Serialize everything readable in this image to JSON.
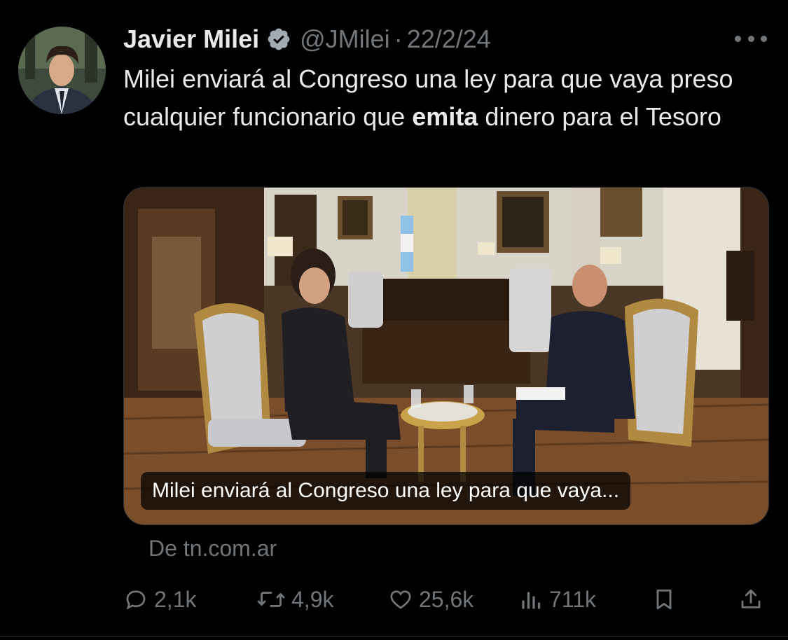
{
  "author": {
    "name": "Javier Milei",
    "handle": "@JMilei",
    "separator": "·",
    "date": "22/2/24",
    "avatar_icon": "profile-photo",
    "verified_icon": "verified-badge-icon"
  },
  "tweet": {
    "text_before": "Milei enviará al Congreso una ley para que vaya preso cualquier funcionario que ",
    "text_bold": "emita",
    "text_after": " dinero para el Tesoro"
  },
  "media": {
    "caption": "Milei enviará al Congreso una ley para que vaya..."
  },
  "source": "De tn.com.ar",
  "actions": {
    "reply_count": "2,1k",
    "retweet_count": "4,9k",
    "like_count": "25,6k",
    "views_count": "711k"
  },
  "colors": {
    "background": "#000000",
    "text": "#e7e9ea",
    "secondary": "#71767b",
    "verified": "#a2aab2"
  }
}
